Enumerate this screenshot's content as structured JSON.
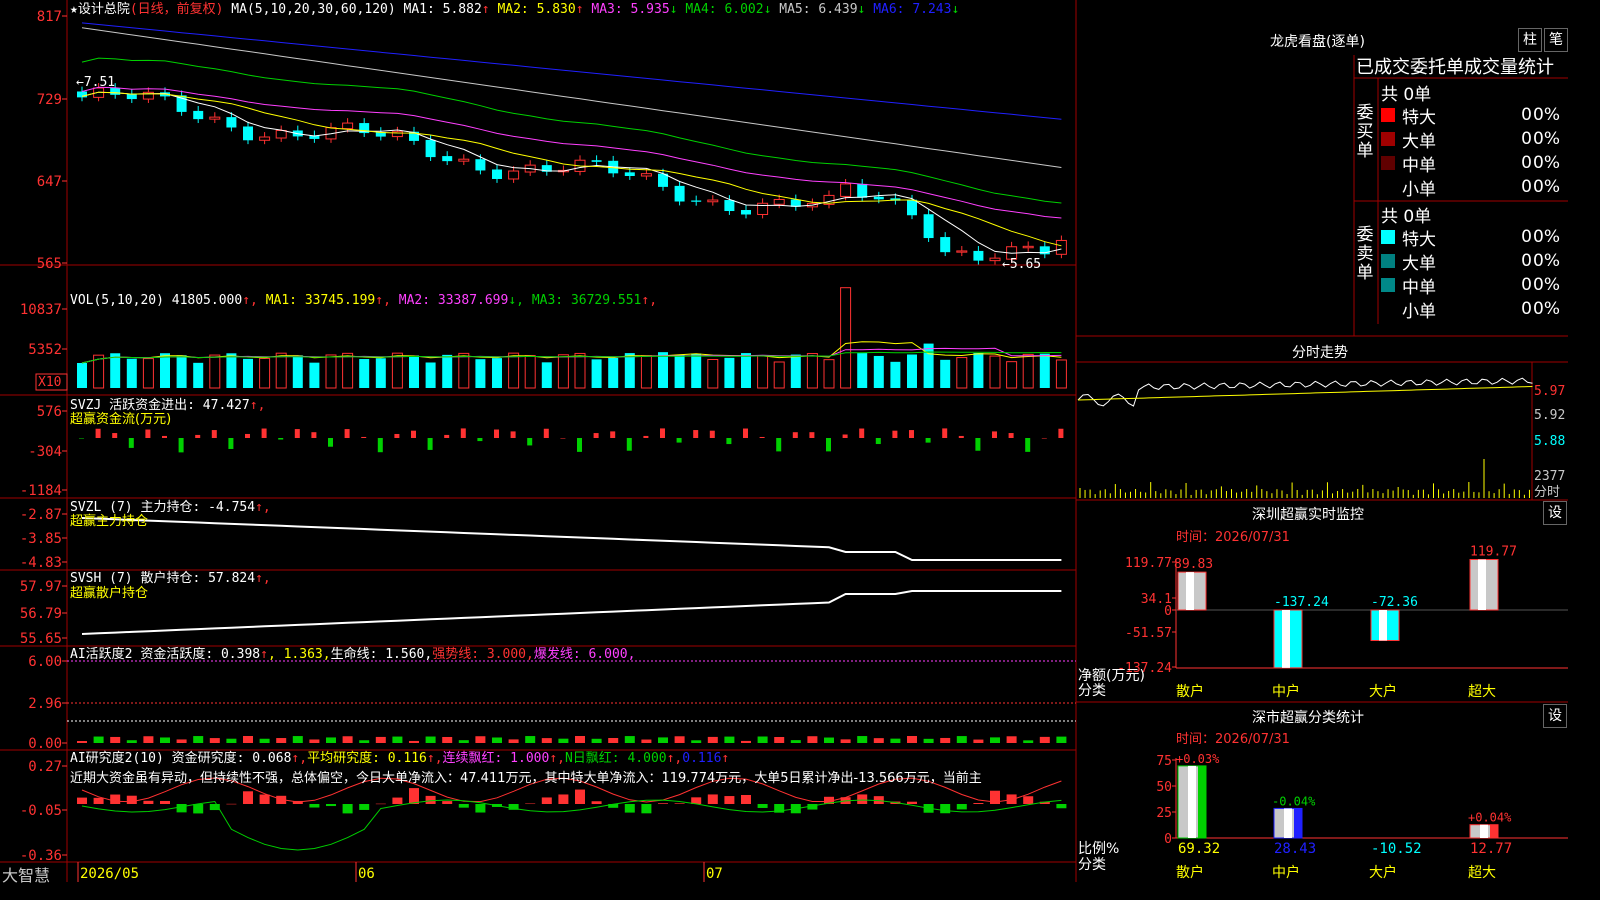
{
  "app": {
    "logo": "大智慧",
    "lock_icon": "lock-icon"
  },
  "colors": {
    "up": "#ff3232",
    "down": "#00ffff",
    "grid": "#a00000",
    "green": "#00d000",
    "yellow": "#ffff00",
    "magenta": "#ff40ff",
    "white": "#ffffff"
  },
  "main": {
    "title": "★设计总院",
    "period": "(日线，前复权)",
    "ma_prefix": "MA(5,10,20,30,60,120)",
    "ma": [
      {
        "label": "MA1:",
        "value": "5.882",
        "arrow": "↑",
        "color": "#ffffff"
      },
      {
        "label": "MA2:",
        "value": "5.830",
        "arrow": "↑",
        "color": "#ffff00"
      },
      {
        "label": "MA3:",
        "value": "5.935",
        "arrow": "↓",
        "color": "#ff40ff"
      },
      {
        "label": "MA4:",
        "value": "6.002",
        "arrow": "↓",
        "color": "#00d000"
      },
      {
        "label": "MA5:",
        "value": "6.439",
        "arrow": "↓",
        "color": "#c8c8c8"
      },
      {
        "label": "MA6:",
        "value": "7.243",
        "arrow": "↓",
        "color": "#2020ff"
      }
    ],
    "high_label": "←7.51",
    "low_label": "←5.65",
    "yticks": [
      "817",
      "729",
      "647",
      "565"
    ]
  },
  "vol": {
    "prefix": "VOL(5,10,20)",
    "value": "41805.000",
    "arrow": "↑",
    "ma": [
      {
        "label": "MA1:",
        "value": "33745.199",
        "arrow": "↑",
        "color": "#ffff00"
      },
      {
        "label": "MA2:",
        "value": "33387.699",
        "arrow": "↓",
        "color": "#ff40ff"
      },
      {
        "label": "MA3:",
        "value": "36729.551",
        "arrow": "↑",
        "color": "#00d000"
      }
    ],
    "yticks": [
      "10837",
      "5352"
    ],
    "unit": "X10"
  },
  "svzj": {
    "prefix": "SVZJ",
    "label": "活跃资金进出:",
    "value": "47.427",
    "arrow": "↑,",
    "sub": "超赢资金流(万元)",
    "yticks": [
      "576",
      "-304",
      "-1184"
    ]
  },
  "svzl": {
    "prefix": "SVZL (7)",
    "label": "主力持仓:",
    "value": "-4.754",
    "arrow": "↑,",
    "sub": "超赢主力持仓",
    "yticks": [
      "-2.87",
      "-3.85",
      "-4.83"
    ]
  },
  "svsh": {
    "prefix": "SVSH (7)",
    "label": "散户持仓:",
    "value": "57.824",
    "arrow": "↑,",
    "sub": "超赢散户持仓",
    "yticks": [
      "57.97",
      "56.79",
      "55.65"
    ]
  },
  "ai2": {
    "prefix": "AI活跃度2",
    "items": [
      {
        "text": "资金活跃度: 0.398",
        "color": "#ffffff",
        "arrow": "↑"
      },
      {
        "text": ", 1.363,",
        "color": "#ffff00",
        "arrow": ""
      },
      {
        "text": "生命线: 1.560,",
        "color": "#ffffff",
        "arrow": ""
      },
      {
        "text": "强势线: 3.000,",
        "color": "#ff3232",
        "arrow": ""
      },
      {
        "text": "爆发线: 6.000,",
        "color": "#ff40ff",
        "arrow": ""
      }
    ],
    "yticks": [
      "6.00",
      "2.96",
      "0.00"
    ]
  },
  "ai_research": {
    "prefix": "AI研究度2(10)",
    "items": [
      {
        "text": "资金研究度: 0.068",
        "color": "#ffffff",
        "arrow": "↑,"
      },
      {
        "text": "平均研究度: 0.116",
        "color": "#ffff00",
        "arrow": "↑,"
      },
      {
        "text": "连续飘红: 1.000",
        "color": "#ff40ff",
        "arrow": "↑,"
      },
      {
        "text": "N日飘红: 4.000",
        "color": "#00d000",
        "arrow": "↑,"
      },
      {
        "text": "0.116",
        "color": "#2020ff",
        "arrow": "↑"
      }
    ],
    "comment": "近期大资金虽有异动，但持续性不强，总体偏空，今日大单净流入：47.411万元，其中特大单净流入：119.774万元，大单5日累计净出-13.566万元，当前主",
    "yticks": [
      "0.27",
      "-0.05",
      "-0.36"
    ]
  },
  "xaxis": [
    "2026/05",
    "06",
    "07"
  ],
  "longhu": {
    "title": "龙虎看盘(逐单)",
    "btn1": "柱",
    "btn2": "笔",
    "tabs": [
      "已成交",
      "委托单",
      "成交量",
      "统计"
    ],
    "buy": {
      "side": "委\n买\n单",
      "total": "共 0单",
      "rows": [
        {
          "name": "特大",
          "v": "0",
          "p": "0%",
          "color": "#ff0000"
        },
        {
          "name": "大单",
          "v": "0",
          "p": "0%",
          "color": "#a00000"
        },
        {
          "name": "中单",
          "v": "0",
          "p": "0%",
          "color": "#600000"
        },
        {
          "name": "小单",
          "v": "0",
          "p": "0%",
          "color": ""
        }
      ]
    },
    "sell": {
      "side": "委\n卖\n单",
      "total": "共 0单",
      "rows": [
        {
          "name": "特大",
          "v": "0",
          "p": "0%",
          "color": "#00ffff"
        },
        {
          "name": "大单",
          "v": "0",
          "p": "0%",
          "color": "#008080"
        },
        {
          "name": "中单",
          "v": "0",
          "p": "0%",
          "color": "#008888"
        },
        {
          "name": "小单",
          "v": "0",
          "p": "0%",
          "color": ""
        }
      ]
    }
  },
  "minute": {
    "title": "分时走势",
    "yticks": [
      "5.97",
      "5.92",
      "5.88"
    ],
    "vol_top": "2377",
    "vol_unit": "分时"
  },
  "chart_data": [
    {
      "type": "bar",
      "title": "深圳超赢实时监控",
      "subtitle": "时间：2026/07/31",
      "button": "设",
      "categories": [
        "散户",
        "中户",
        "大户",
        "超大"
      ],
      "values": [
        89.83,
        -137.24,
        -72.36,
        119.77
      ],
      "ylabel": "净额(万元)",
      "xlabel": "分类",
      "ylim": [
        -137.24,
        119.77
      ],
      "yticks": [
        "119.77",
        "34.1",
        "0",
        "-51.57",
        "-137.24"
      ]
    },
    {
      "type": "bar",
      "title": "深市超赢分类统计",
      "subtitle": "时间：2026/07/31",
      "button": "设",
      "categories": [
        "散户",
        "中户",
        "大户",
        "超大"
      ],
      "values": [
        69.32,
        28.43,
        -10.52,
        12.77
      ],
      "change_labels": [
        "+0.03%",
        "-0.04%",
        "",
        "+0.04%"
      ],
      "ylabel": "比例%",
      "xlabel": "分类",
      "ylim": [
        0,
        75
      ],
      "yticks": [
        "75",
        "50",
        "25",
        "0"
      ]
    }
  ]
}
